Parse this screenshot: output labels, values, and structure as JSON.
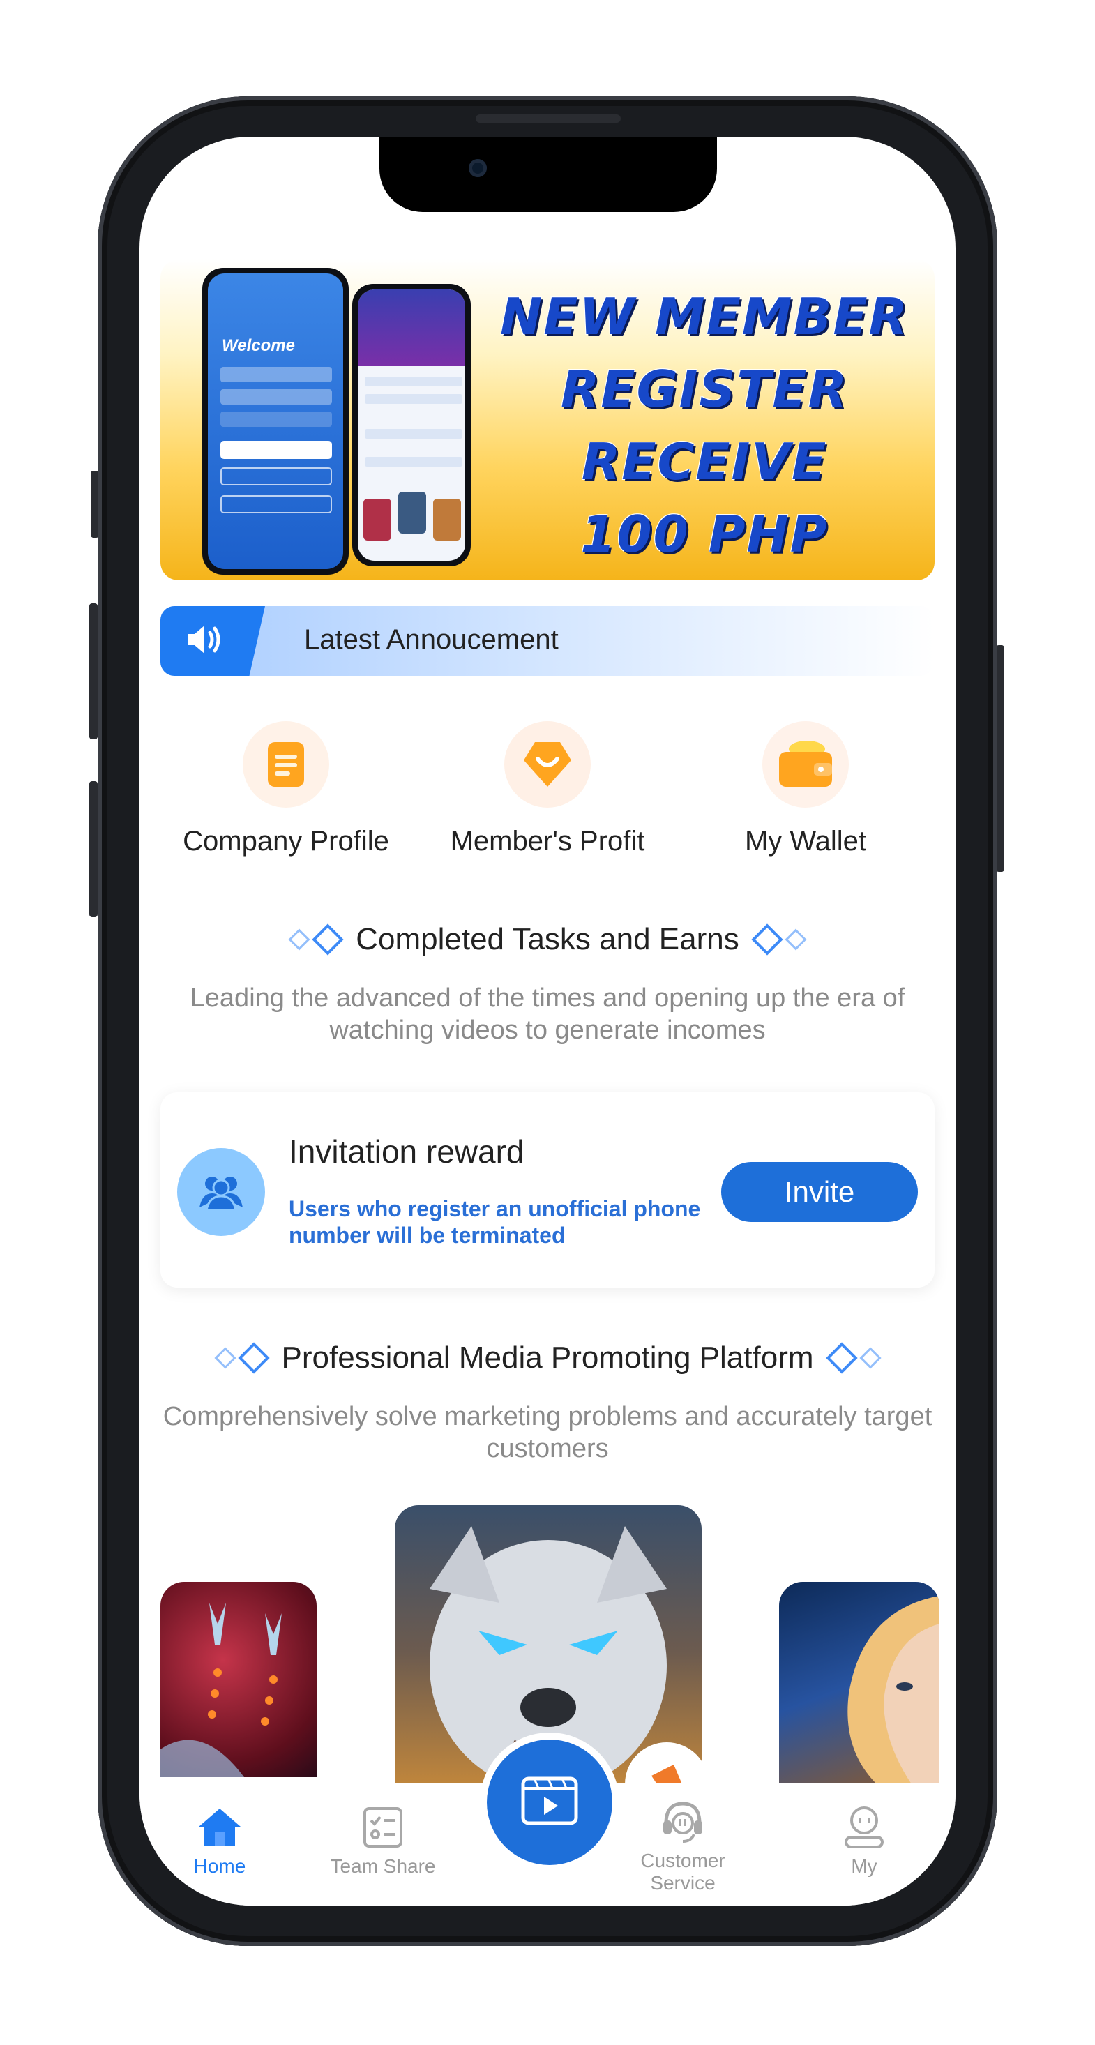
{
  "banner": {
    "lines": [
      "NEW MEMBER",
      "REGISTER",
      "RECEIVE",
      "100 PHP"
    ],
    "mini_phone_welcome": "Welcome"
  },
  "announcement": {
    "text": "Latest Annoucement"
  },
  "quick_links": [
    {
      "label": "Company Profile",
      "icon": "document-icon"
    },
    {
      "label": "Member's Profit",
      "icon": "smile-badge-icon"
    },
    {
      "label": "My Wallet",
      "icon": "wallet-icon"
    }
  ],
  "tasks_section": {
    "title": "Completed Tasks and Earns",
    "subtitle": "Leading the advanced of the times and opening up the era of watching videos to generate incomes"
  },
  "invitation": {
    "title": "Invitation reward",
    "description": "Users who register an unofficial phone number will be terminated",
    "button_label": "Invite"
  },
  "media_section": {
    "title": "Professional Media Promoting Platform",
    "subtitle": "Comprehensively solve marketing problems and accurately target customers"
  },
  "bottom_nav": {
    "items": [
      {
        "label": "Home",
        "icon": "home-icon",
        "active": true
      },
      {
        "label": "Team Share",
        "icon": "checklist-icon",
        "active": false
      },
      {
        "label": "",
        "icon": "video-icon",
        "active": false
      },
      {
        "label": "Customer Service",
        "icon": "headset-icon",
        "active": false
      },
      {
        "label": "My",
        "icon": "user-icon",
        "active": false
      }
    ]
  },
  "colors": {
    "primary": "#1e6fd9",
    "accent_blue": "#1f7bf2",
    "banner_gold": "#f5b41a",
    "icon_orange": "#ffa51f"
  }
}
